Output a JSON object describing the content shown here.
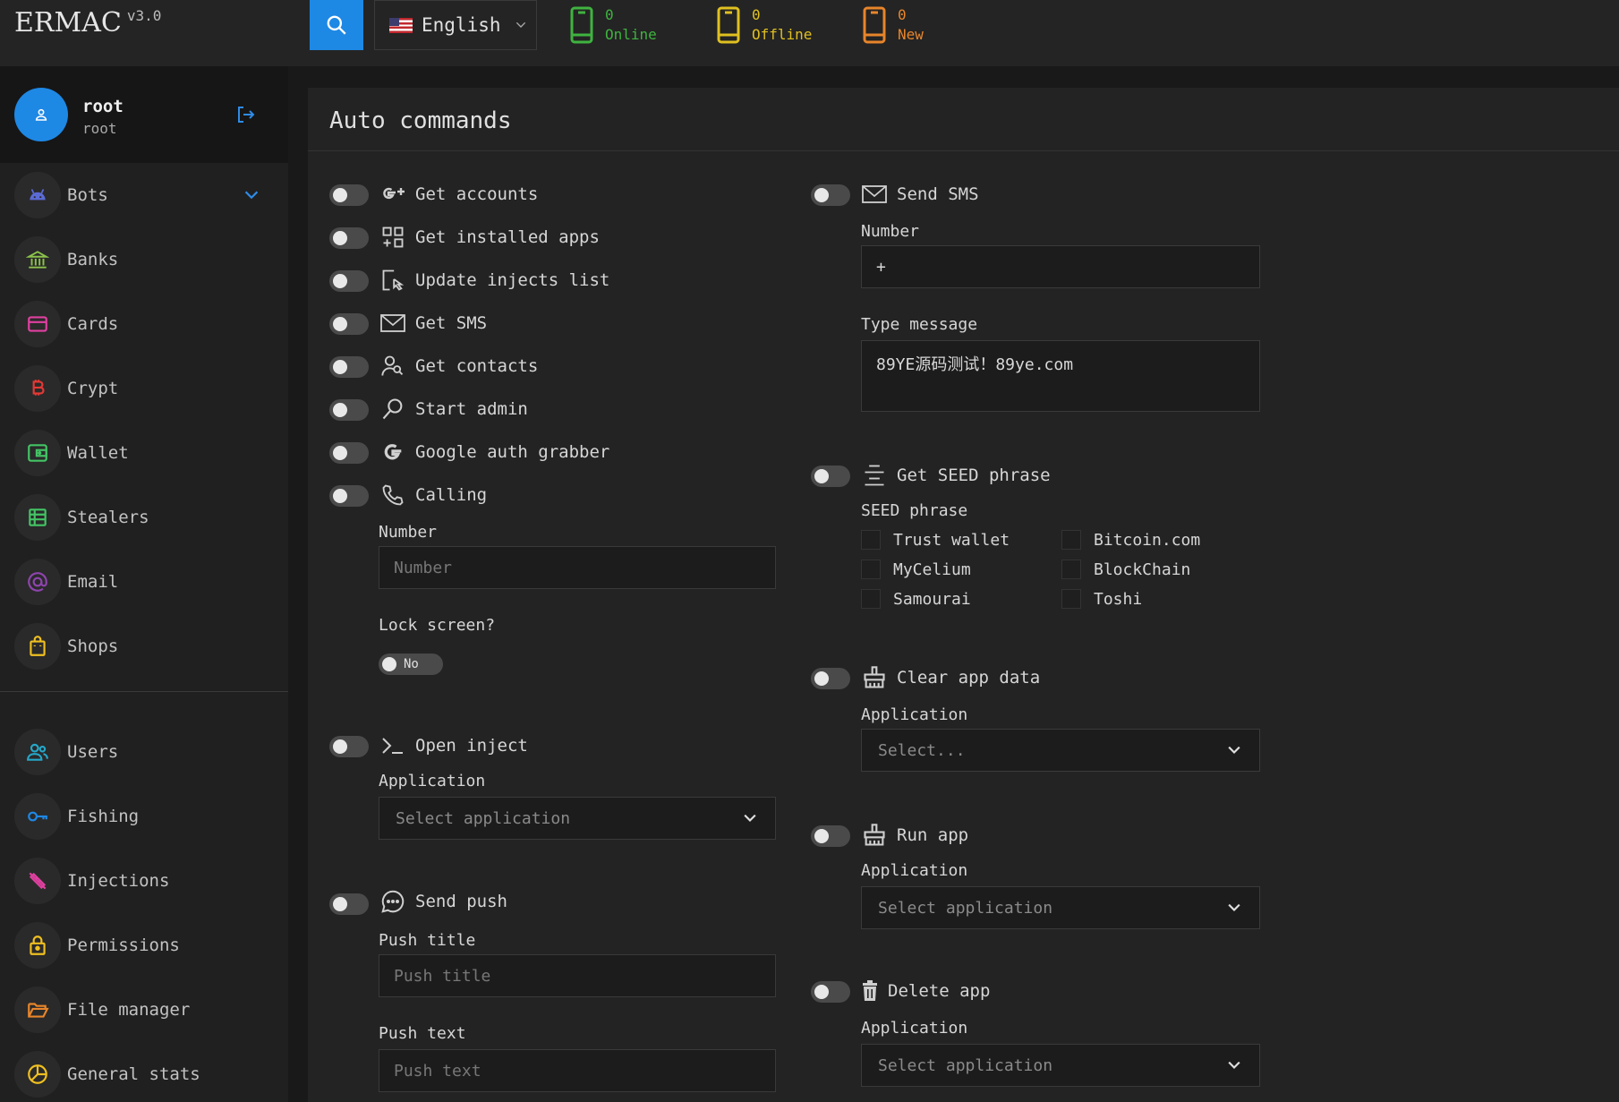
{
  "header": {
    "brand": "ERMAC",
    "version": "v3.0",
    "language": "English",
    "stats": [
      {
        "count": "0",
        "label": "Online",
        "color": "#3fb33f"
      },
      {
        "count": "0",
        "label": "Offline",
        "color": "#e0c020"
      },
      {
        "count": "0",
        "label": "New",
        "color": "#e8852a"
      }
    ]
  },
  "user": {
    "name": "root",
    "role": "root"
  },
  "sidebar": {
    "items": [
      {
        "label": "Bots",
        "icon": "android-icon",
        "color": "#5b6bd6"
      },
      {
        "label": "Banks",
        "icon": "bank-icon",
        "color": "#8bc34a"
      },
      {
        "label": "Cards",
        "icon": "credit-card-icon",
        "color": "#e040a0"
      },
      {
        "label": "Crypt",
        "icon": "bitcoin-icon",
        "color": "#e53935"
      },
      {
        "label": "Wallet",
        "icon": "wallet-icon",
        "color": "#43c465"
      },
      {
        "label": "Stealers",
        "icon": "list-icon",
        "color": "#43c465"
      },
      {
        "label": "Email",
        "icon": "at-sign-icon",
        "color": "#8e44ad"
      },
      {
        "label": "Shops",
        "icon": "shopping-bag-icon",
        "color": "#f0c020"
      },
      {
        "label": "Users",
        "icon": "users-icon",
        "color": "#26a7c9"
      },
      {
        "label": "Fishing",
        "icon": "key-icon",
        "color": "#1e88e5"
      },
      {
        "label": "Injections",
        "icon": "syringe-icon",
        "color": "#e040a0"
      },
      {
        "label": "Permissions",
        "icon": "lock-icon",
        "color": "#f0c020"
      },
      {
        "label": "File manager",
        "icon": "folder-open-icon",
        "color": "#e8852a"
      },
      {
        "label": "General stats",
        "icon": "pie-chart-icon",
        "color": "#f0c020"
      }
    ]
  },
  "main": {
    "title": "Auto commands",
    "left_commands": [
      {
        "label": "Get accounts",
        "icon": "google-plus-icon"
      },
      {
        "label": "Get installed apps",
        "icon": "apps-grid-icon"
      },
      {
        "label": "Update injects list",
        "icon": "cursor-select-icon"
      },
      {
        "label": "Get SMS",
        "icon": "envelope-icon"
      },
      {
        "label": "Get contacts",
        "icon": "contacts-icon"
      },
      {
        "label": "Start admin",
        "icon": "magnifier-icon"
      },
      {
        "label": "Google auth grabber",
        "icon": "google-icon"
      },
      {
        "label": "Calling",
        "icon": "phone-icon"
      }
    ],
    "calling": {
      "number_label": "Number",
      "number_placeholder": "Number",
      "lock_label": "Lock screen?",
      "lock_value": "No"
    },
    "open_inject": {
      "label": "Open inject",
      "app_label": "Application",
      "app_placeholder": "Select application"
    },
    "send_push": {
      "label": "Send push",
      "title_label": "Push title",
      "title_placeholder": "Push title",
      "text_label": "Push text",
      "text_placeholder": "Push text"
    },
    "send_sms": {
      "label": "Send SMS",
      "number_label": "Number",
      "number_value": "+",
      "message_label": "Type message",
      "message_value": "89YE源码测试！89ye.com"
    },
    "seed": {
      "label": "Get SEED phrase",
      "phrase_label": "SEED phrase",
      "options": [
        "Trust wallet",
        "Bitcoin.com",
        "MyCelium",
        "BlockChain",
        "Samourai",
        "Toshi"
      ]
    },
    "clear_app": {
      "label": "Clear app data",
      "app_label": "Application",
      "app_placeholder": "Select..."
    },
    "run_app": {
      "label": "Run app",
      "app_label": "Application",
      "app_placeholder": "Select application"
    },
    "delete_app": {
      "label": "Delete app",
      "app_label": "Application",
      "app_placeholder": "Select application"
    }
  }
}
